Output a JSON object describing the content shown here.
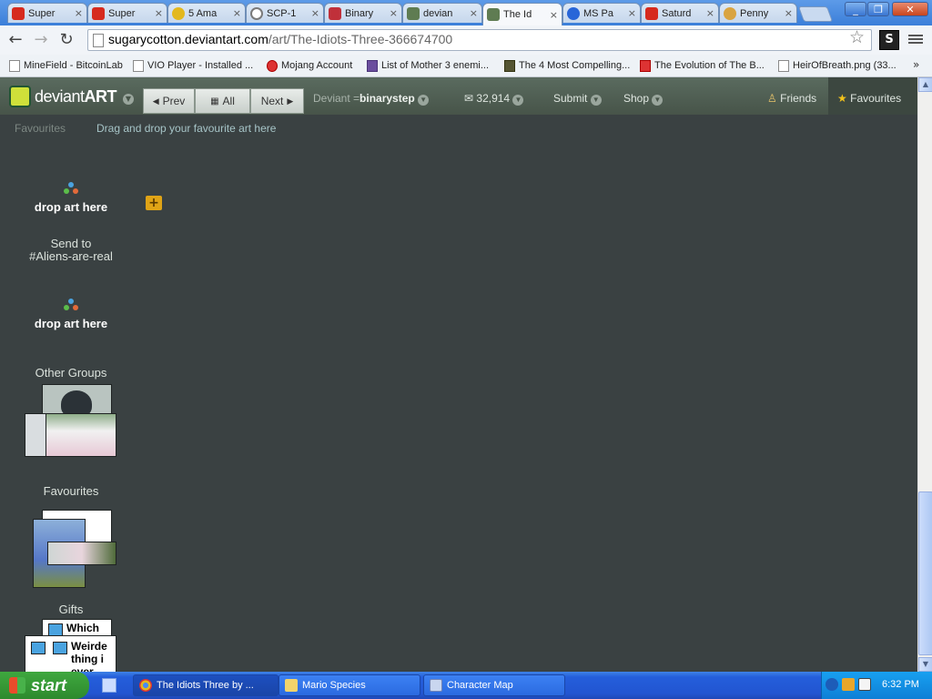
{
  "browser": {
    "tabs": [
      {
        "label": "Super",
        "icon": "mario-icon",
        "color": "#d62a1e"
      },
      {
        "label": "Super",
        "icon": "mario-icon",
        "color": "#d62a1e"
      },
      {
        "label": "5 Ama",
        "icon": "coin-icon",
        "color": "#e3b81d"
      },
      {
        "label": "SCP-1",
        "icon": "scp-icon",
        "color": "#7a7a7a"
      },
      {
        "label": "Binary",
        "icon": "dice-icon",
        "color": "#c0303a"
      },
      {
        "label": "devian",
        "icon": "deviantart-icon",
        "color": "#5f7c52"
      },
      {
        "label": "The Id",
        "icon": "deviantart-icon",
        "color": "#5f7c52"
      },
      {
        "label": "MS Pa",
        "icon": "megaman-icon",
        "color": "#2866d8"
      },
      {
        "label": "Saturd",
        "icon": "smbc-icon",
        "color": "#d62a1e"
      },
      {
        "label": "Penny",
        "icon": "face-icon",
        "color": "#d9a441"
      }
    ],
    "close_glyph": "×",
    "url_host": "sugarycotton.deviantart.com",
    "url_path": "/art/The-Idiots-Three-366674700",
    "bookmarks": [
      {
        "label": "MineField - BitcoinLab",
        "icon": "page-icon"
      },
      {
        "label": "VIO Player - Installed ...",
        "icon": "page-icon"
      },
      {
        "label": "Mojang Account",
        "icon": "mojang-icon"
      },
      {
        "label": "List of Mother 3 enemi...",
        "icon": "wiki-icon"
      },
      {
        "label": "The 4 Most Compelling...",
        "icon": "cracked-icon"
      },
      {
        "label": "The Evolution of The B...",
        "icon": "b-icon"
      },
      {
        "label": "HeirOfBreath.png (33...",
        "icon": "page-icon"
      }
    ],
    "more_glyph": "»",
    "extension_label": "S"
  },
  "da": {
    "logo_pre": "deviant",
    "logo_post": "ART",
    "prev": "Prev",
    "all": "All",
    "next": "Next",
    "deviant_label": "Deviant",
    "deviant_prefix": "=",
    "deviant_name": "binarystep",
    "messages": "32,914",
    "submit": "Submit",
    "shop": "Shop",
    "friends": "Friends",
    "favourites": "Favourites"
  },
  "subbar": {
    "favourites": "Favourites",
    "hint": "Drag and drop your favourite art here"
  },
  "sidebar": {
    "drop1": "drop art here",
    "send_line1": "Send to",
    "send_line2": "#Aliens-are-real",
    "drop2": "drop art here",
    "other_groups": "Other Groups",
    "favourites": "Favourites",
    "gifts": "Gifts",
    "gift_text_1": "Which",
    "gift_text_2": "Weirde",
    "gift_text_3": "thing i",
    "gift_text_4": "ever"
  },
  "taskbar": {
    "start": "start",
    "tasks": [
      {
        "label": "The Idiots Three by ...",
        "icon": "chrome-icon"
      },
      {
        "label": "Mario Species",
        "icon": "folder-icon"
      },
      {
        "label": "Character Map",
        "icon": "charmap-icon"
      }
    ],
    "clock": "6:32 PM"
  }
}
